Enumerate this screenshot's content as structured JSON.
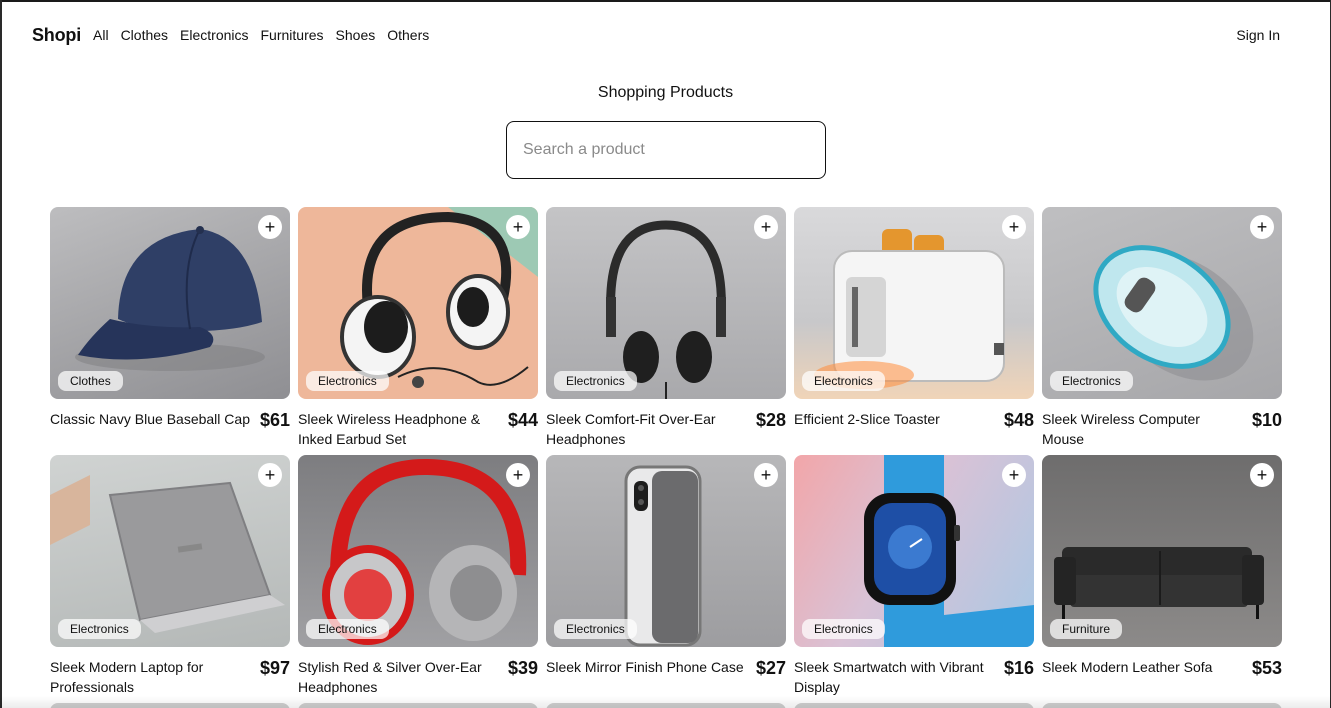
{
  "nav": {
    "brand": "Shopi",
    "links": [
      "All",
      "Clothes",
      "Electronics",
      "Furnitures",
      "Shoes",
      "Others"
    ],
    "sign_in": "Sign In"
  },
  "page": {
    "title": "Shopping Products"
  },
  "search": {
    "placeholder": "Search a product",
    "value": ""
  },
  "add_symbol": "+",
  "products": [
    {
      "name": "Classic Navy Blue Baseball Cap",
      "price": "$61",
      "category": "Clothes",
      "image": "navy-cap"
    },
    {
      "name": "Sleek Wireless Headphone & Inked Earbud Set",
      "price": "$44",
      "category": "Electronics",
      "image": "white-headphones"
    },
    {
      "name": "Sleek Comfort-Fit Over-Ear Headphones",
      "price": "$28",
      "category": "Electronics",
      "image": "black-headphones"
    },
    {
      "name": "Efficient 2-Slice Toaster",
      "price": "$48",
      "category": "Electronics",
      "image": "toaster"
    },
    {
      "name": "Sleek Wireless Computer Mouse",
      "price": "$10",
      "category": "Electronics",
      "image": "mouse"
    },
    {
      "name": "Sleek Modern Laptop for Professionals",
      "price": "$97",
      "category": "Electronics",
      "image": "laptop"
    },
    {
      "name": "Stylish Red & Silver Over-Ear Headphones",
      "price": "$39",
      "category": "Electronics",
      "image": "red-headphones"
    },
    {
      "name": "Sleek Mirror Finish Phone Case",
      "price": "$27",
      "category": "Electronics",
      "image": "phone-case"
    },
    {
      "name": "Sleek Smartwatch with Vibrant Display",
      "price": "$16",
      "category": "Electronics",
      "image": "smartwatch"
    },
    {
      "name": "Sleek Modern Leather Sofa",
      "price": "$53",
      "category": "Furniture",
      "image": "sofa"
    }
  ]
}
